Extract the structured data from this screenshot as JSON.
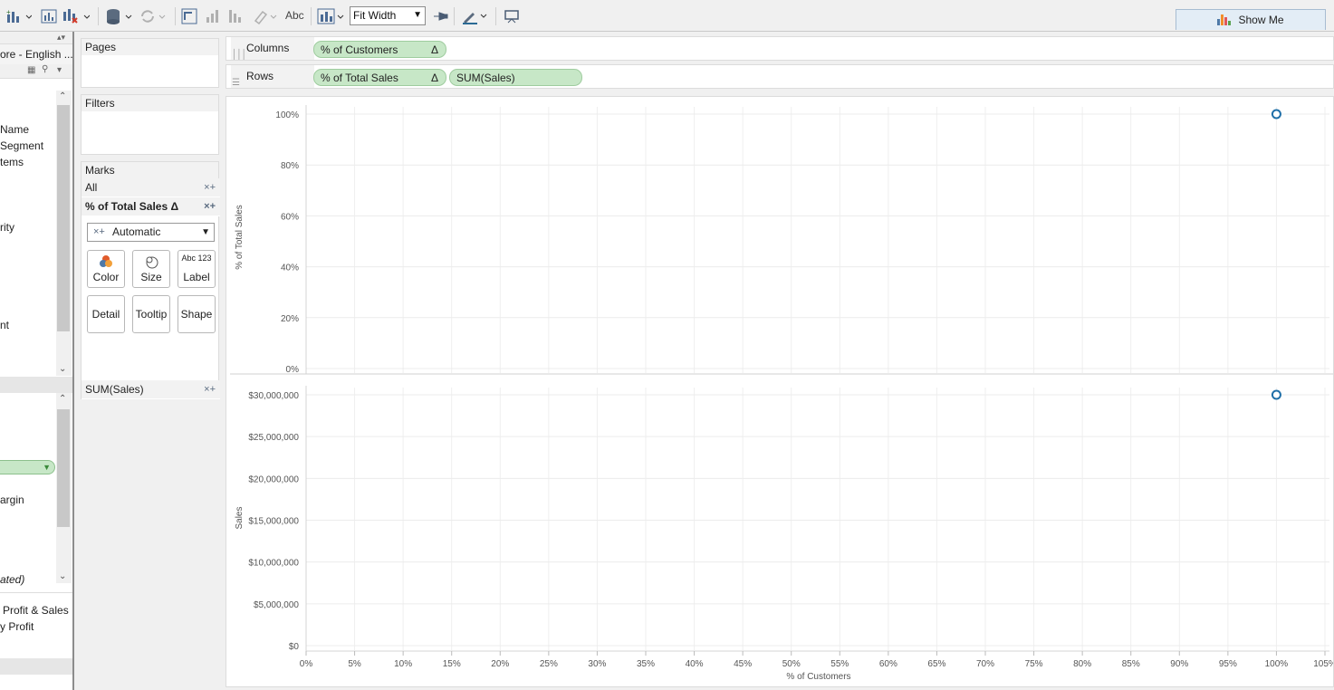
{
  "toolbar": {
    "abc_label": "Abc",
    "fit_label": "Fit Width",
    "show_me_label": "Show Me",
    "show_me_colors": [
      "#4e79a7",
      "#f28e2b",
      "#e15759",
      "#59a14f"
    ]
  },
  "data_pane": {
    "source_label": "ore - English ...",
    "dimensions": [
      "Name",
      "Segment",
      "tems",
      "",
      "rity",
      "",
      "nt"
    ],
    "measures": [
      "argin",
      "ated)"
    ],
    "sets": [
      "Profit & Sales",
      "y Profit"
    ]
  },
  "pages": {
    "title": "Pages"
  },
  "filters": {
    "title": "Filters"
  },
  "marks": {
    "title": "Marks",
    "all_label": "All",
    "pane1_label": "% of Total Sales Δ",
    "mark_type": "Automatic",
    "buttons": [
      "Color",
      "Size",
      "Label",
      "Detail",
      "Tooltip",
      "Shape"
    ],
    "label_icon_text": "Abc 123",
    "pane2_label": "SUM(Sales)"
  },
  "shelves": {
    "columns_label": "Columns",
    "rows_label": "Rows",
    "columns_pills": [
      "% of Customers"
    ],
    "rows_pills": [
      "% of Total Sales",
      "SUM(Sales)"
    ],
    "delta": "Δ"
  },
  "chart_data": [
    {
      "type": "scatter",
      "title": "",
      "xlabel": "% of Customers",
      "ylabel": "% of Total Sales",
      "x_ticks": [
        "0%",
        "5%",
        "10%",
        "15%",
        "20%",
        "25%",
        "30%",
        "35%",
        "40%",
        "45%",
        "50%",
        "55%",
        "60%",
        "65%",
        "70%",
        "75%",
        "80%",
        "85%",
        "90%",
        "95%",
        "100%",
        "105%"
      ],
      "xlim": [
        0,
        105
      ],
      "y_ticks": [
        "0%",
        "20%",
        "40%",
        "60%",
        "80%",
        "100%"
      ],
      "ylim": [
        0,
        100
      ],
      "grid": true,
      "points": [
        {
          "x": 100,
          "y": 100
        }
      ],
      "marker_color": "#1f6fa8"
    },
    {
      "type": "scatter",
      "title": "",
      "xlabel": "% of Customers",
      "ylabel": "Sales",
      "x_ticks": [
        "0%",
        "5%",
        "10%",
        "15%",
        "20%",
        "25%",
        "30%",
        "35%",
        "40%",
        "45%",
        "50%",
        "55%",
        "60%",
        "65%",
        "70%",
        "75%",
        "80%",
        "85%",
        "90%",
        "95%",
        "100%",
        "105%"
      ],
      "xlim": [
        0,
        105
      ],
      "y_ticks": [
        "$0",
        "$5,000,000",
        "$10,000,000",
        "$15,000,000",
        "$20,000,000",
        "$25,000,000",
        "$30,000,000"
      ],
      "ylim": [
        0,
        30000000
      ],
      "grid": true,
      "points": [
        {
          "x": 100,
          "y": 30000000
        }
      ],
      "marker_color": "#1f6fa8"
    }
  ]
}
